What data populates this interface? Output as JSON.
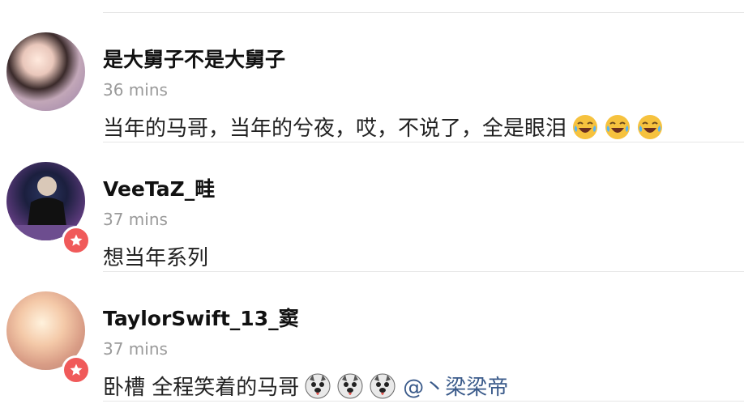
{
  "comments": [
    {
      "username": "是大舅子不是大舅子",
      "time": "36 mins",
      "text": "当年的马哥，当年的兮夜，哎，不说了，全是眼泪",
      "emojis": [
        "tears-of-joy",
        "tears-of-joy",
        "tears-of-joy"
      ],
      "badge": false
    },
    {
      "username": "VeeTaZ_畦",
      "time": "37 mins",
      "text": "想当年系列",
      "badge": true
    },
    {
      "username": "TaylorSwift_13_窦",
      "time": "37 mins",
      "text": "卧槽 全程笑着的马哥",
      "emojis": [
        "husky",
        "husky",
        "husky"
      ],
      "mention": "@丶梁梁帝",
      "badge": true
    }
  ],
  "colors": {
    "badge": "#f05a5a",
    "mention": "#3a5a8a",
    "time": "#9a9a9a"
  }
}
